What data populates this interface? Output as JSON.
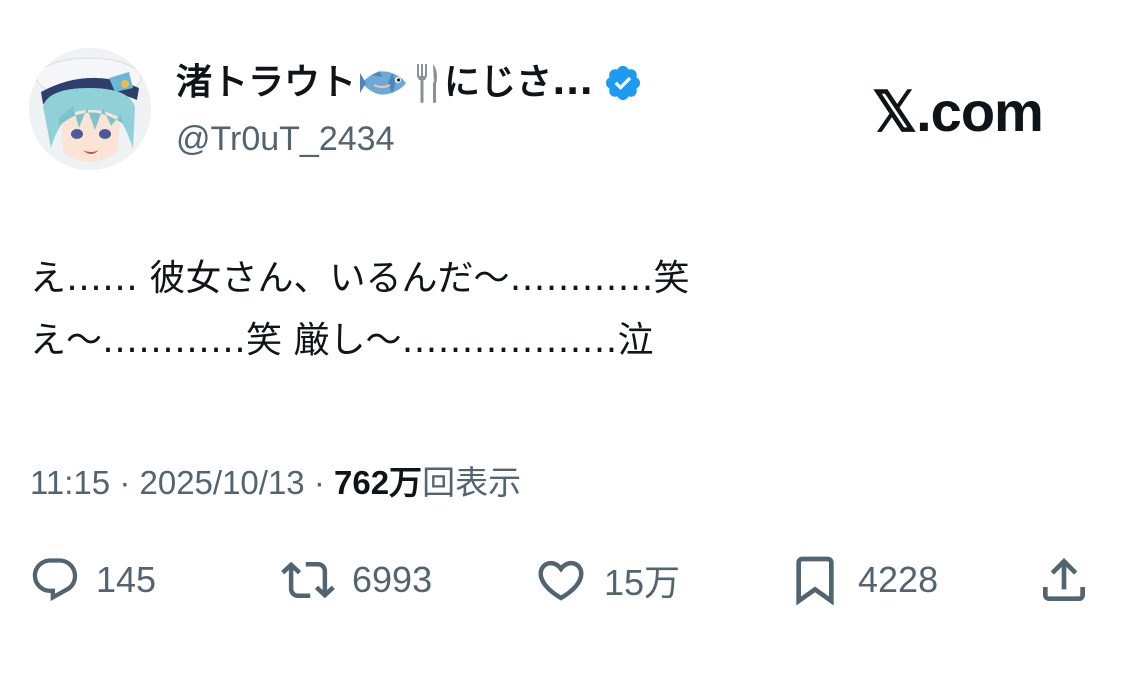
{
  "header": {
    "display_name": "渚トラウト",
    "name_emoji_fish": "🐟",
    "name_emoji_utensils": "🍴",
    "name_suffix": "にじさ...",
    "handle": "@Tr0uT_2434",
    "verified_color": "#1d9bf0"
  },
  "brand": {
    "label": "𝕏.com"
  },
  "tweet": {
    "lines": [
      "え…… 彼女さん、いるんだ〜…………笑",
      "え〜…………笑 厳し〜………………泣"
    ]
  },
  "meta": {
    "time": "11:15",
    "separator": "·",
    "date": "2025/10/13",
    "views_count": "762万",
    "views_label": "回表示"
  },
  "actions": {
    "reply_count": "145",
    "retweet_count": "6993",
    "like_count": "15万",
    "bookmark_count": "4228"
  },
  "colors": {
    "text_primary": "#0f1419",
    "text_secondary": "#536471",
    "accent": "#1d9bf0"
  }
}
